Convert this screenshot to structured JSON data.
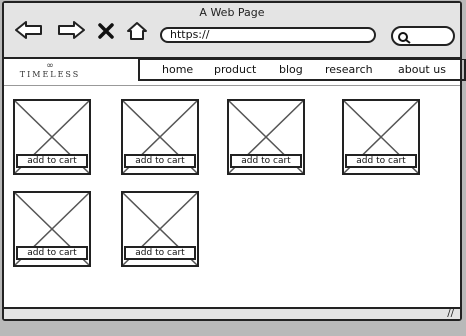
{
  "window": {
    "title": "A Web Page"
  },
  "browser": {
    "address": "https://"
  },
  "site": {
    "logo_text": "TIMELESS"
  },
  "nav": {
    "items": [
      "home",
      "product",
      "blog",
      "research",
      "about us"
    ]
  },
  "products": [
    {
      "button_label": "add to cart"
    },
    {
      "button_label": "add to cart"
    },
    {
      "button_label": "add to cart"
    },
    {
      "button_label": "add to cart"
    },
    {
      "button_label": "add to cart"
    },
    {
      "button_label": "add to cart"
    }
  ],
  "icons": {
    "back": "arrow-left-icon",
    "forward": "arrow-right-icon",
    "close": "close-icon",
    "home": "home-icon",
    "search": "search-icon",
    "resize": "resize-grip-icon",
    "logo": "infinity-icon"
  }
}
